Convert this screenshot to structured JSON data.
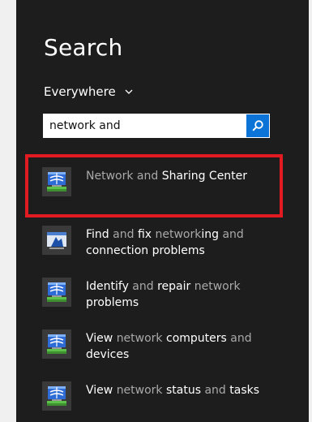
{
  "search": {
    "title": "Search",
    "scope": "Everywhere",
    "query": "network and"
  },
  "results": [
    {
      "icon": "network-globe-icon",
      "parts": [
        {
          "t": "Network",
          "dim": true
        },
        {
          "t": " and ",
          "dim": true
        },
        {
          "t": "Sharing Center",
          "dim": false
        }
      ]
    },
    {
      "icon": "troubleshoot-network-icon",
      "parts": [
        {
          "t": "Find",
          "dim": false
        },
        {
          "t": " and ",
          "dim": true
        },
        {
          "t": "fix ",
          "dim": false
        },
        {
          "t": "network",
          "dim": true
        },
        {
          "t": "ing",
          "dim": false
        },
        {
          "t": " and ",
          "dim": true
        },
        {
          "t": "connection problems",
          "dim": false
        }
      ]
    },
    {
      "icon": "network-globe-icon",
      "parts": [
        {
          "t": "Identify",
          "dim": false
        },
        {
          "t": " and ",
          "dim": true
        },
        {
          "t": "repair ",
          "dim": false
        },
        {
          "t": "network",
          "dim": true
        },
        {
          "t": " problems",
          "dim": false
        }
      ]
    },
    {
      "icon": "network-globe-icon",
      "parts": [
        {
          "t": "View ",
          "dim": false
        },
        {
          "t": "network",
          "dim": true
        },
        {
          "t": " computers ",
          "dim": false
        },
        {
          "t": "and",
          "dim": true
        },
        {
          "t": " devices",
          "dim": false
        }
      ]
    },
    {
      "icon": "network-globe-icon",
      "parts": [
        {
          "t": "View ",
          "dim": false
        },
        {
          "t": "network",
          "dim": true
        },
        {
          "t": " status ",
          "dim": false
        },
        {
          "t": "and",
          "dim": true
        },
        {
          "t": " tasks",
          "dim": false
        }
      ]
    }
  ],
  "colors": {
    "pane": "#1d1d1d",
    "accent": "#0b74d6",
    "highlight": "#e21b23",
    "dim_text": "#a9a9a9"
  }
}
